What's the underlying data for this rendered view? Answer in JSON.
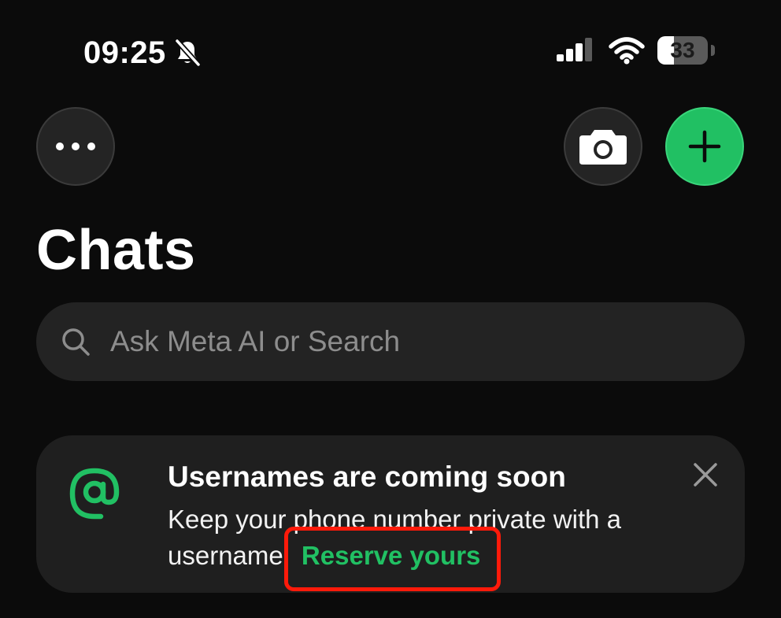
{
  "status_bar": {
    "time": "09:25",
    "battery_percent": "33",
    "battery_level": 0.33,
    "silent_mode": true
  },
  "header": {
    "more_icon": "ellipsis-icon",
    "camera_icon": "camera-icon",
    "new_chat_icon": "plus-icon"
  },
  "title": "Chats",
  "search": {
    "placeholder": "Ask Meta AI or Search",
    "value": ""
  },
  "banner": {
    "icon": "at-sign-icon",
    "title": "Usernames are coming soon",
    "body": "Keep your phone number private with a username.",
    "link": "Reserve yours",
    "close_icon": "close-icon"
  },
  "colors": {
    "background": "#0b0b0b",
    "accent_green": "#21c063",
    "surface": "#232323",
    "highlight_outline": "#ff1a0a"
  }
}
